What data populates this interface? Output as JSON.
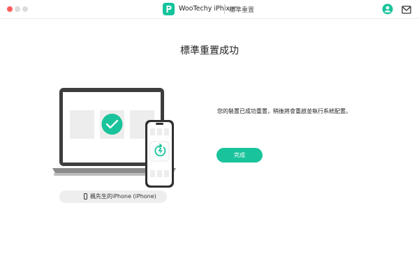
{
  "window": {
    "app_name": "WooTechy iPhixer",
    "mode": "標準重置"
  },
  "main": {
    "title": "標準重置成功",
    "message": "您的裝置已成功重置，稍後將會重啟並執行系統配置。",
    "done_button": "完成",
    "device_name": "楓先生的iPhone (iPhone)"
  },
  "icons": {
    "app_logo": "wootechy-logo-icon",
    "user": "user-account-icon",
    "mail": "mail-icon",
    "success": "checkmark-icon",
    "reset": "power-restart-icon",
    "device": "iphone-icon"
  },
  "colors": {
    "accent": "#19c39b",
    "close_light": "#fc5c57",
    "inactive_light": "#dcdcdc"
  }
}
